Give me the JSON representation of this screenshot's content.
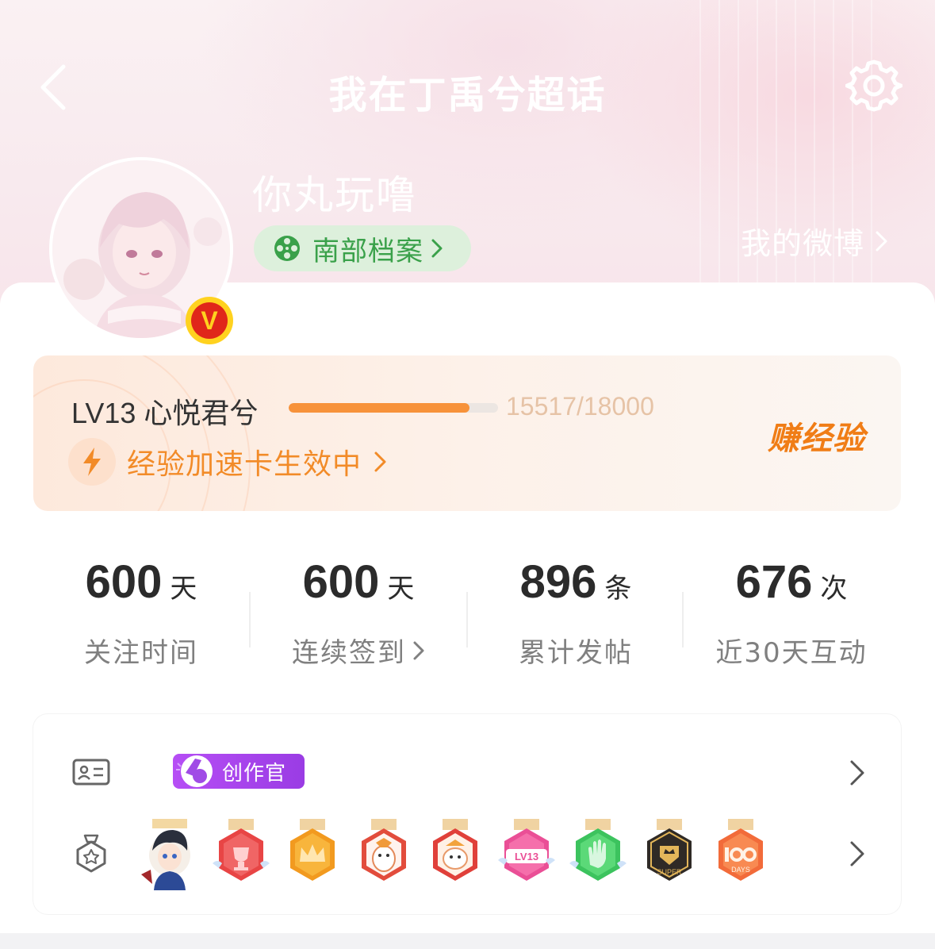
{
  "header": {
    "title": "我在丁禹兮超话"
  },
  "profile": {
    "username": "你丸玩噜",
    "archive_label": "南部档案",
    "my_weibo_label": "我的微博"
  },
  "level": {
    "name": "LV13 心悦君兮",
    "progress_text": "15517/18000",
    "progress_fraction": 0.862,
    "boost_text": "经验加速卡生效中",
    "earn_label": "赚经验"
  },
  "stats": [
    {
      "value": "600",
      "unit": "天",
      "label": "关注时间",
      "has_arrow": false
    },
    {
      "value": "600",
      "unit": "天",
      "label": "连续签到",
      "has_arrow": true
    },
    {
      "value": "896",
      "unit": "条",
      "label": "累计发帖",
      "has_arrow": false
    },
    {
      "value": "676",
      "unit": "次",
      "label": "近30天互动",
      "has_arrow": false
    }
  ],
  "badges": {
    "creator_tag": "创作官",
    "medal_texts": [
      "LV13",
      "SUPER",
      "DAYS"
    ],
    "medal_names": [
      "avatar-medal",
      "trophy-medal",
      "crown-medal",
      "creature-medal",
      "cat-medal",
      "lv13-medal",
      "hand-medal",
      "super-medal",
      "100days-medal"
    ]
  },
  "colors": {
    "accent_orange": "#f28b28",
    "progress": "#f7923a",
    "archive_green": "#3aa14a",
    "creator_purple": "#b64ef5"
  }
}
